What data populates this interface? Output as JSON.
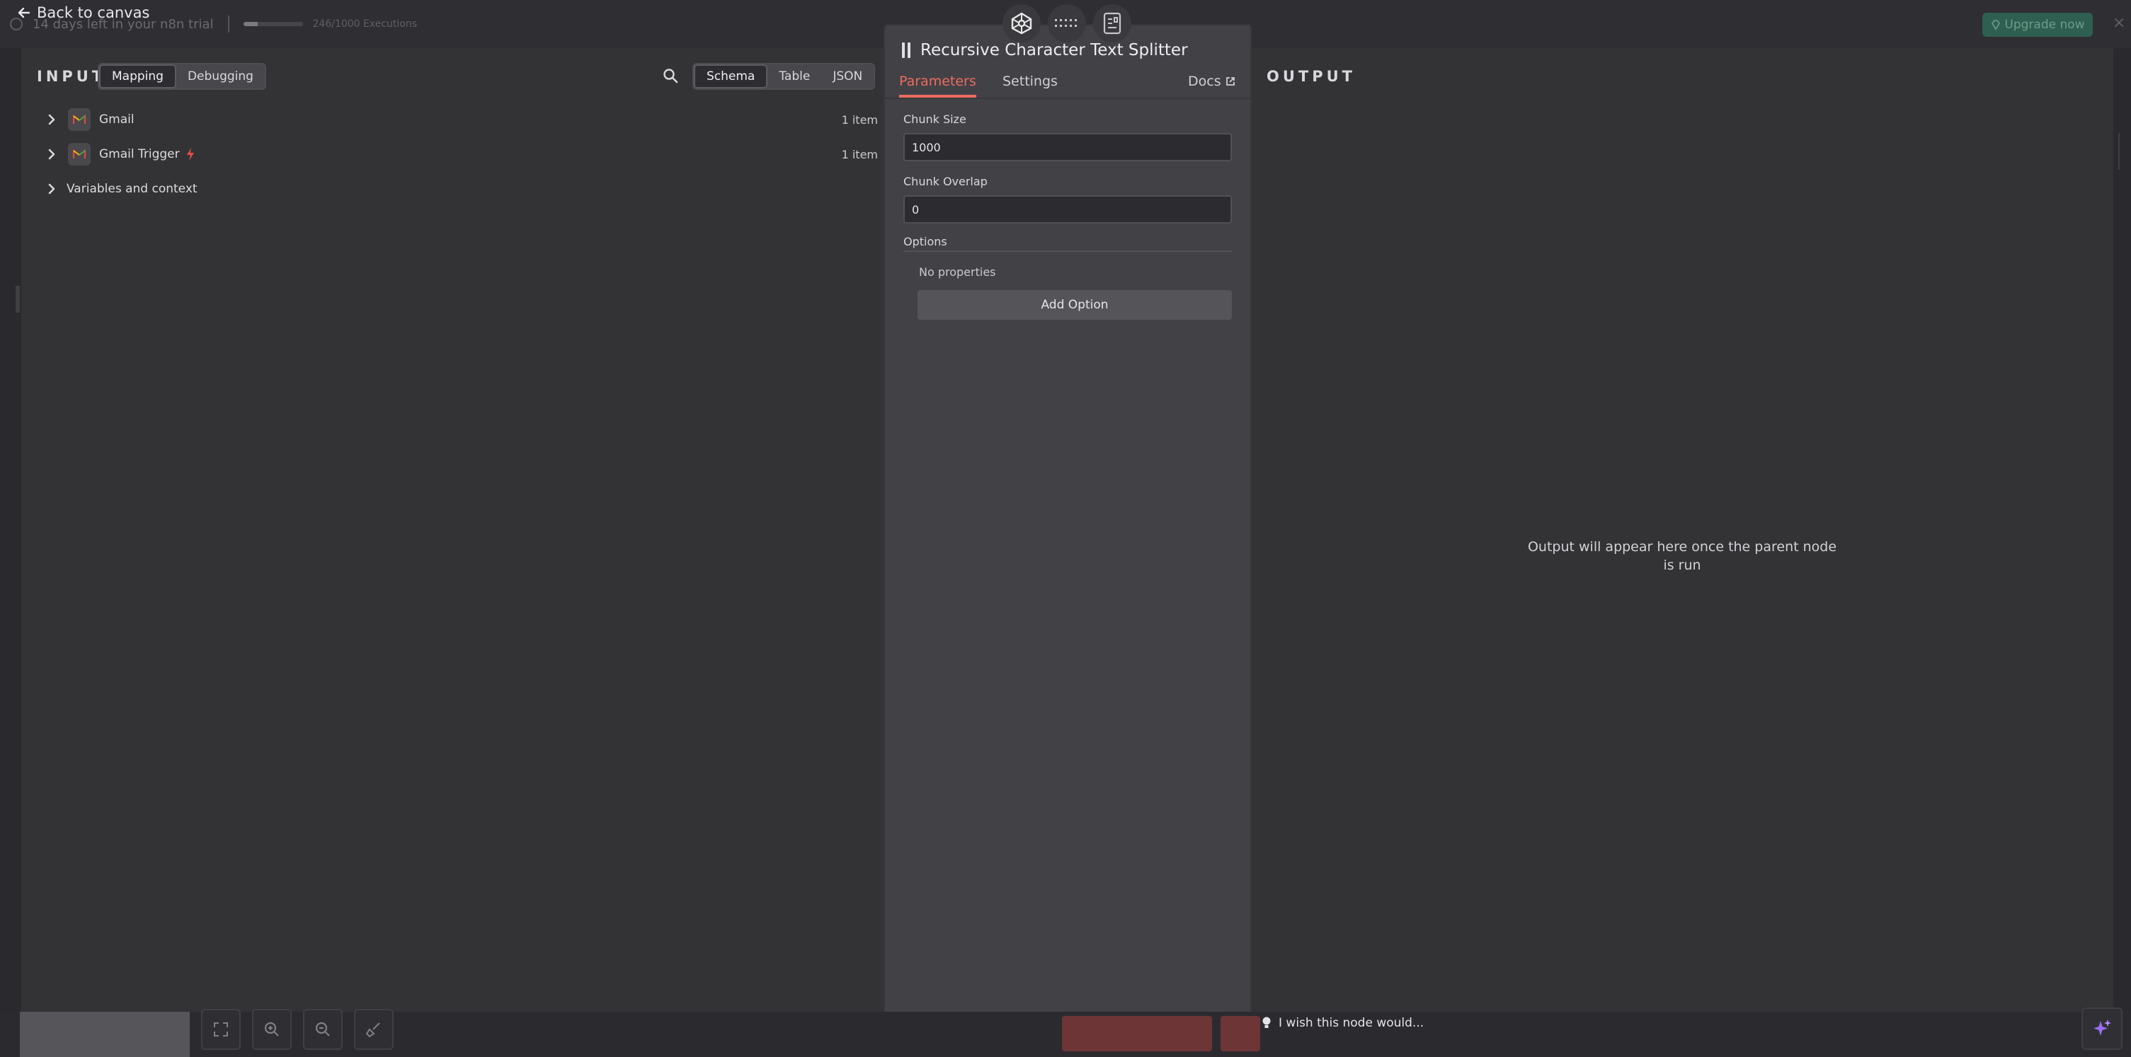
{
  "background": {
    "trial_text": "14 days left in your n8n trial",
    "executions_text": "246/1000 Executions",
    "executions_used_fraction": 0.246,
    "upgrade_label": "Upgrade now",
    "close_glyph": "×"
  },
  "back_link": {
    "label": "Back to canvas",
    "icon": "arrow-left-icon"
  },
  "input_panel": {
    "heading": "INPUT",
    "mode_tabs": [
      {
        "label": "Mapping",
        "active": true
      },
      {
        "label": "Debugging",
        "active": false
      }
    ],
    "view_tabs": [
      {
        "label": "Schema",
        "active": true
      },
      {
        "label": "Table",
        "active": false
      },
      {
        "label": "JSON",
        "active": false
      }
    ],
    "nodes": [
      {
        "name": "Gmail",
        "count": "1 item",
        "icon": "gmail-icon"
      },
      {
        "name": "Gmail Trigger",
        "count": "1 item",
        "icon": "gmail-icon",
        "badge": "lightning-icon"
      }
    ],
    "variables_label": "Variables and context"
  },
  "node_panel": {
    "title": "Recursive Character Text Splitter",
    "tabs": [
      {
        "label": "Parameters",
        "active": true
      },
      {
        "label": "Settings",
        "active": false
      }
    ],
    "docs_label": "Docs",
    "fields": [
      {
        "label": "Chunk Size",
        "value": "1000"
      },
      {
        "label": "Chunk Overlap",
        "value": "0"
      }
    ],
    "options_label": "Options",
    "no_properties": "No properties",
    "add_option_label": "Add Option"
  },
  "output_panel": {
    "heading": "OUTPUT",
    "message": "Output will appear here once the parent node is run"
  },
  "footer": {
    "feedback_placeholder": "I wish this node would..."
  },
  "colors": {
    "accent": "#ee6b5f",
    "upgrade": "#2f5f50",
    "panel_bg": "#333336",
    "center_bg": "#424246"
  }
}
